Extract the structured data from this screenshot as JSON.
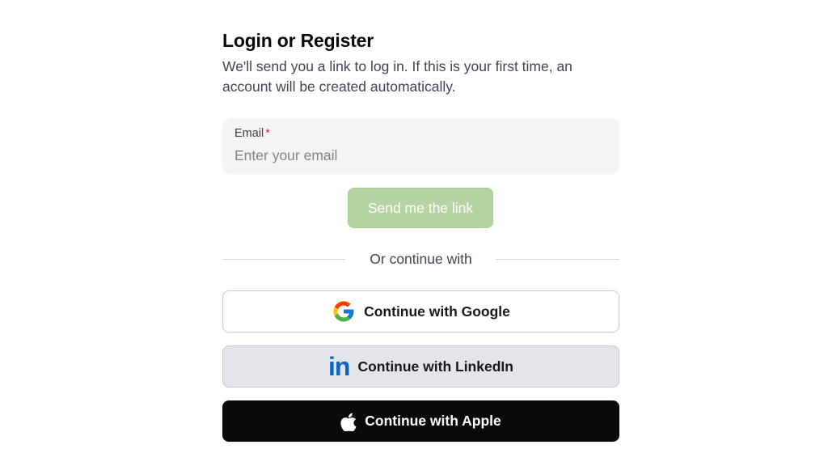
{
  "header": {
    "title": "Login or Register",
    "subtitle": "We'll send you a link to log in. If this is your first time, an account will be created automatically."
  },
  "email": {
    "label": "Email",
    "required_mark": "*",
    "placeholder": "Enter your email",
    "value": ""
  },
  "send_button": {
    "label": "Send me the link",
    "state": "disabled"
  },
  "divider": {
    "label": "Or continue with"
  },
  "oauth": {
    "google": {
      "label": "Continue with Google",
      "icon": "google-g-icon"
    },
    "linkedin": {
      "label": "Continue with LinkedIn",
      "icon": "linkedin-in-icon",
      "logo_text": "in"
    },
    "apple": {
      "label": "Continue with Apple",
      "icon": "apple-icon"
    }
  },
  "colors": {
    "send_button_bg": "#b4d4a2",
    "required": "#e11d48",
    "linkedin_brand": "#0a66c2",
    "apple_bg": "#0a0a0a",
    "input_bg": "#f4f4f5"
  }
}
